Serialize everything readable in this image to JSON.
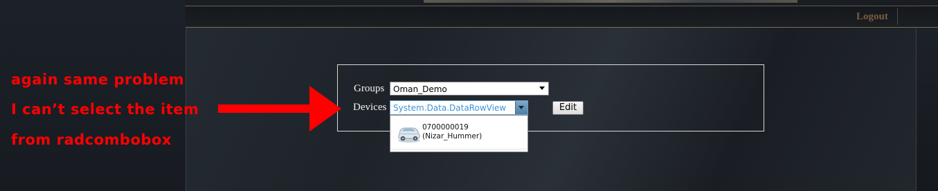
{
  "header": {
    "logout_label": "Logout"
  },
  "form": {
    "groups_label": "Groups",
    "groups_value": "Oman_Demo",
    "devices_label": "Devices",
    "devices_value": "System.Data.DataRowView",
    "edit_label": "Edit"
  },
  "dropdown": {
    "items": [
      {
        "line1": "0700000019",
        "line2": "(Nizar_Hummer)",
        "icon": "car-icon"
      }
    ]
  },
  "annotation": {
    "lines": [
      "again same problem",
      "I can’t select the item",
      "from radcombobox"
    ],
    "color": "#ff0000"
  },
  "colors": {
    "logout": "#7b5d3e",
    "devices_text": "#3f93d4",
    "annotation": "#ff0000"
  }
}
